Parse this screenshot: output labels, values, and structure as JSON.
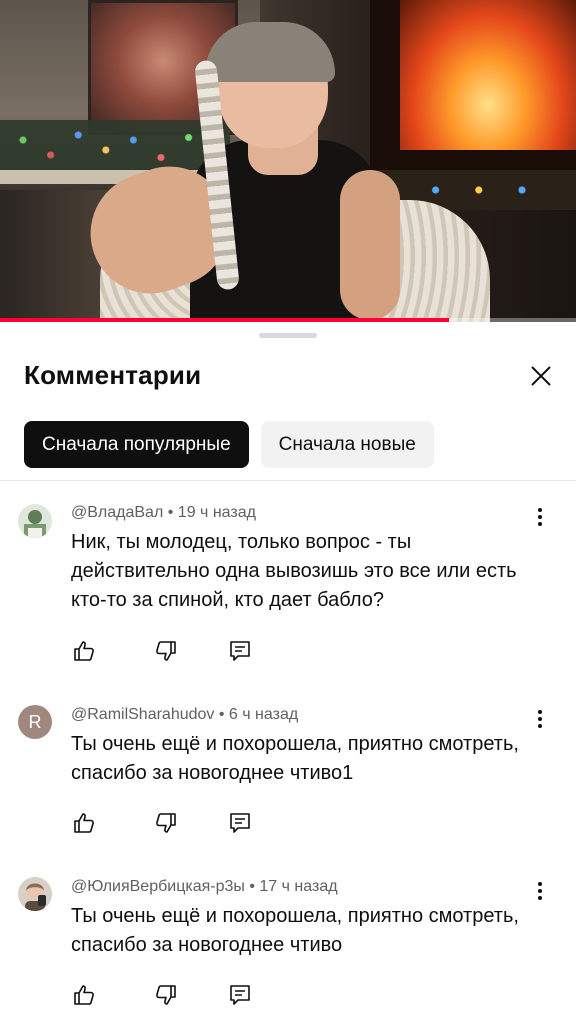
{
  "video": {
    "progress_fraction": 0.78
  },
  "sheet": {
    "title": "Комментарии",
    "close_icon": "close-icon",
    "sort_chips": [
      {
        "label": "Сначала популярные",
        "active": true
      },
      {
        "label": "Сначала новые",
        "active": false
      }
    ]
  },
  "comments": [
    {
      "author": "@ВладаВал",
      "time": "19 ч назад",
      "text": "Ник, ты молодец, только вопрос - ты действительно одна вывозишь это все или есть кто-то за спиной, кто дает бабло?",
      "avatar_letter": ""
    },
    {
      "author": "@RamilSharahudov",
      "time": "6 ч назад",
      "text": "Ты очень ещё и похорошела, приятно смотреть, спасибо за новогоднее чтиво1",
      "avatar_letter": "R"
    },
    {
      "author": "@ЮлияВербицкая-р3ы",
      "time": "17 ч назад",
      "text": "Ты очень ещё и похорошела, приятно смотреть, спасибо за новогоднее чтиво",
      "avatar_letter": ""
    }
  ],
  "colors": {
    "accent": "#ff0033",
    "chip_active_bg": "#0f0f0f",
    "chip_inactive_bg": "#f2f2f2",
    "meta_text": "#606060",
    "avatar_r": "#a1887f"
  }
}
